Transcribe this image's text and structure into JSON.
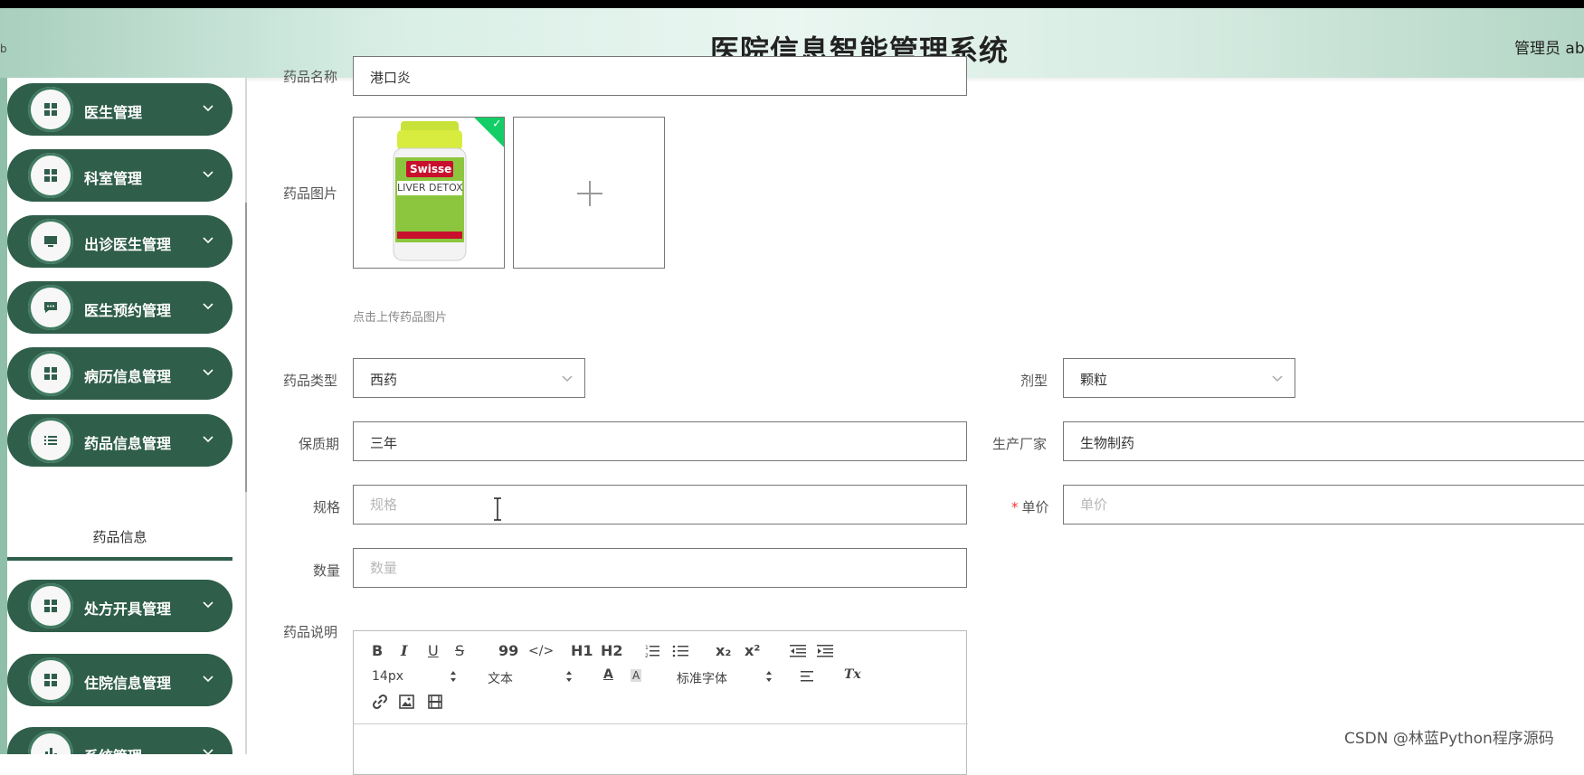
{
  "header": {
    "title": "医院信息智能管理系统",
    "user": "管理员 ab",
    "edge_tick": "b"
  },
  "sidebar": {
    "items": [
      {
        "label": "医生管理",
        "icon": "grid-icon"
      },
      {
        "label": "科室管理",
        "icon": "grid-icon"
      },
      {
        "label": "出诊医生管理",
        "icon": "monitor-icon"
      },
      {
        "label": "医生预约管理",
        "icon": "chat-icon"
      },
      {
        "label": "病历信息管理",
        "icon": "grid-icon"
      },
      {
        "label": "药品信息管理",
        "icon": "list-icon"
      },
      {
        "label": "处方开具管理",
        "icon": "grid-icon"
      },
      {
        "label": "住院信息管理",
        "icon": "grid-icon"
      },
      {
        "label": "系统管理",
        "icon": "chart-icon"
      }
    ],
    "active_sub": "药品信息"
  },
  "form": {
    "name_label": "药品名称",
    "name_value": "港口炎",
    "image_label": "药品图片",
    "image_product": {
      "brand": "Swisse",
      "name": "LIVER DETOX"
    },
    "upload_hint": "点击上传药品图片",
    "type_label": "药品类型",
    "type_value": "西药",
    "form_label": "剂型",
    "form_value": "颗粒",
    "shelf_life_label": "保质期",
    "shelf_life_value": "三年",
    "maker_label": "生产厂家",
    "maker_value": "生物制药",
    "spec_label": "规格",
    "spec_placeholder": "规格",
    "price_label": "单价",
    "price_required": "*",
    "price_placeholder": "单价",
    "qty_label": "数量",
    "qty_placeholder": "数量",
    "desc_label": "药品说明"
  },
  "editor": {
    "bold": "B",
    "italic": "I",
    "underline": "U",
    "strike": "S",
    "quote": "99",
    "code": "</>",
    "h1": "H1",
    "h2": "H2",
    "sub": "x₂",
    "sup": "x²",
    "font_size": "14px",
    "block_type": "文本",
    "font_family": "标准字体",
    "font_color": "A",
    "bg_color": "A",
    "clear": "Tx"
  },
  "watermark": "CSDN @林蓝Python程序源码",
  "colors": {
    "menu_bg": "#2f5e4a",
    "success": "#13ce66",
    "required": "#ee3333"
  }
}
